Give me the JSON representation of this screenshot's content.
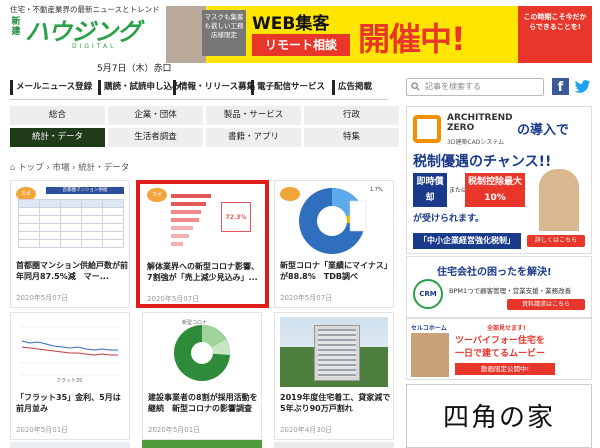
{
  "header": {
    "tagline": "住宅・不動産業界の最新ニュースとトレンド",
    "logo_side": "新建",
    "logo_main": "ハウジング",
    "logo_sub": "DIGITAL",
    "date": "5月7日（木）赤口"
  },
  "banner": {
    "gray_text": "マスクも集客も欲しい工務店様限定",
    "web_text": "WEB集客",
    "remote_text": "リモート相談",
    "kaisai_text": "開催中!",
    "side_text": "この時期こそ今だからできることを!"
  },
  "nav": {
    "items": [
      "メールニュース登録",
      "購読・試読申し込み",
      "情報・リリース募集",
      "電子配信サービス",
      "広告掲載"
    ]
  },
  "search": {
    "placeholder": "記事を検索する"
  },
  "social": {
    "facebook": "f",
    "twitter": "🐦"
  },
  "categories": [
    {
      "label": "総合",
      "active": false
    },
    {
      "label": "企業・団体",
      "active": false
    },
    {
      "label": "製品・サービス",
      "active": false
    },
    {
      "label": "行政",
      "active": false
    },
    {
      "label": "統計・データ",
      "active": true
    },
    {
      "label": "生活者調査",
      "active": false
    },
    {
      "label": "書籍・アプリ",
      "active": false
    },
    {
      "label": "特集",
      "active": false
    }
  ],
  "breadcrumb": {
    "home": "トップ",
    "sep": "›",
    "level1": "市場",
    "level2": "統計・データ"
  },
  "cards": [
    {
      "title": "首都圏マンション供給戸数が前年同月87.5%減　マー...",
      "date": "2020年5月07日"
    },
    {
      "title": "解体業界への新型コロナ影響、7割強が「売上減少見込み」...",
      "date": "2020年5月07日"
    },
    {
      "title": "新型コロナ「業績にマイナス」が88.8%　TDB調べ",
      "date": "2020年5月07日"
    },
    {
      "title": "「フラット35」金利、5月は前月並み",
      "date": "2020年5月01日"
    },
    {
      "title": "建設事業者の8割が採用活動を継続　新型コロナの影響調査",
      "date": "2020年5月01日"
    },
    {
      "title": "2019年度住宅着工、貸家減で5年ぶり90万戸割れ",
      "date": "2020年4月30日"
    }
  ],
  "ads": {
    "ad1": {
      "brand": "ARCHITREND ZERO",
      "brand_sub": "3D建築CADシステム",
      "headline1": "の導入で",
      "headline2": "税制優遇のチャンス!!",
      "badge1": "即時償却",
      "or": "または",
      "badge2": "税制控除最大10%",
      "receive": "が受けられます。",
      "footer": "「中小企業経営強化税制」",
      "more": "詳しくはこちら"
    },
    "ad2": {
      "headline": "住宅会社の困ったを解決!",
      "logo": "CRM",
      "sub": "BPM1つで顧客管理・営業支援・業務改善",
      "cta": "資料請求はこちら"
    },
    "ad3": {
      "brand": "セルコホーム",
      "tagline": "全部見せます!",
      "headline1": "ツーバイフォー住宅を",
      "headline2": "一日で建てるムービー",
      "cta": "動画限定公開中!"
    },
    "ad4": {
      "text": "四角の家"
    }
  },
  "thumbs": {
    "card1_badge": "カボ",
    "card1_header": "首都圏マンション供給",
    "card2_badge": "カボ",
    "card2_value": "72.3%",
    "card3_pct": "1.7%",
    "card4_note": "フラット35",
    "card5_note": "新型コロナ"
  }
}
